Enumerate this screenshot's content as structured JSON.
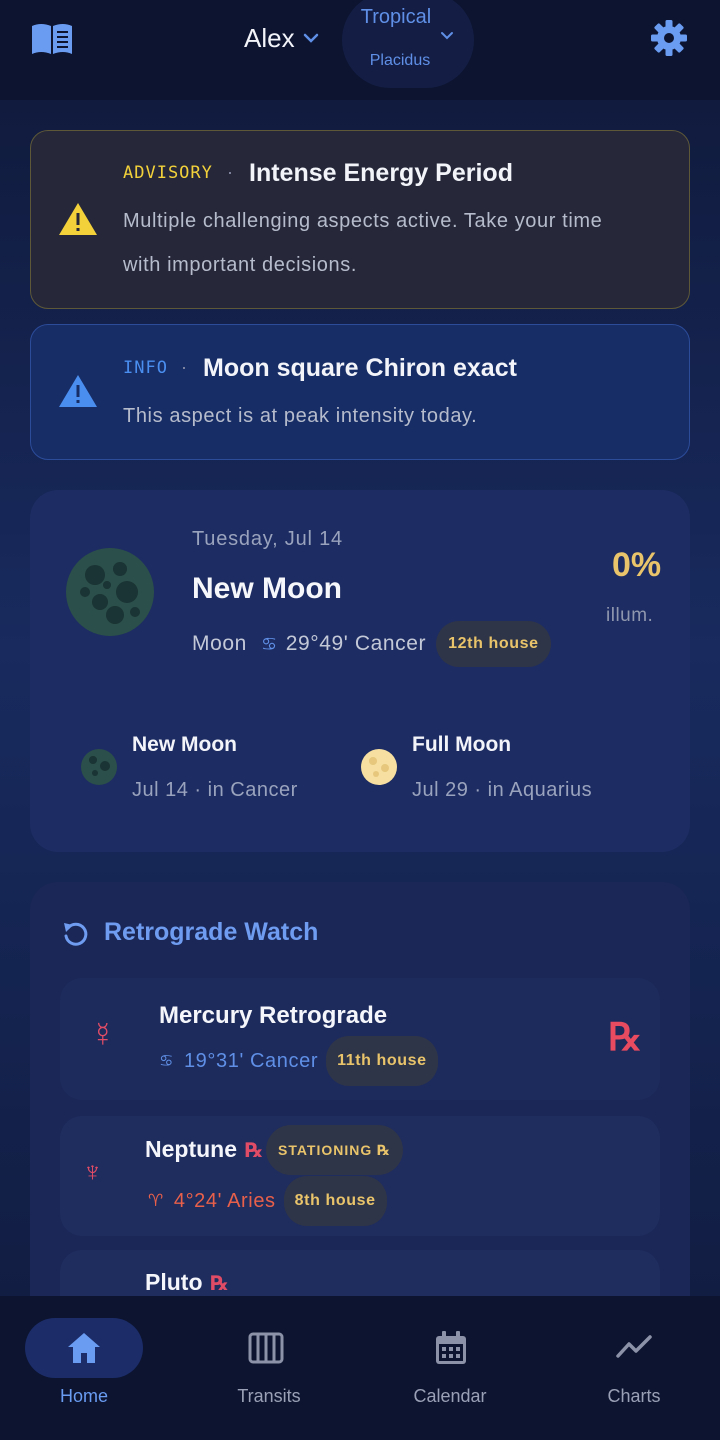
{
  "colors": {
    "accent": "#5f8fe6",
    "gold": "#e9c46a",
    "retro_red": "#e04c66",
    "advisory_yellow": "#f2d13a",
    "info_blue": "#4a8ef0",
    "fire_orange": "#e8604a"
  },
  "header": {
    "profile_name": "Alex",
    "zodiac": "Tropical",
    "house_system": "Placidus",
    "icons": [
      "book-icon",
      "chevron-down-icon",
      "gear-icon"
    ]
  },
  "alerts": [
    {
      "tag": "ADVISORY",
      "separator": "·",
      "title": "Intense Energy Period",
      "body_line1": "Multiple challenging aspects active. Take your time",
      "body_line2": "with important decisions.",
      "icon": "warning-icon"
    },
    {
      "tag": "INFO",
      "separator": "·",
      "title": "Moon square Chiron exact",
      "body_line1": "This aspect is at peak intensity today.",
      "icon": "warning-icon"
    }
  ],
  "moon": {
    "date": "Tuesday, Jul 14",
    "phase": "New Moon",
    "body": "Moon",
    "sign_symbol": "♋",
    "position": "29°49' Cancer",
    "house": "12th house",
    "illumination": "0%",
    "illumination_label": "illum.",
    "illumination_value": 0,
    "upcoming": [
      {
        "name": "New Moon",
        "detail": "Jul 14 · in Cancer",
        "icon": "new-moon-icon"
      },
      {
        "name": "Full Moon",
        "detail": "Jul 29 · in Aquarius",
        "icon": "full-moon-icon"
      }
    ]
  },
  "retrograde": {
    "title": "Retrograde Watch",
    "icon": "retrograde-refresh-icon",
    "planets": [
      {
        "glyph": "☿",
        "name": "Mercury Retrograde",
        "sign_symbol": "♋",
        "position": "19°31' Cancer",
        "house": "11th house",
        "rx": "℞"
      },
      {
        "glyph": "♆",
        "name": "Neptune",
        "rx": "℞",
        "badge": "STATIONING ℞",
        "sign_symbol": "♈",
        "position": "4°24' Aries",
        "house": "8th house"
      },
      {
        "glyph": "♇",
        "name": "Pluto",
        "rx": "℞"
      }
    ]
  },
  "nav": [
    {
      "label": "Home",
      "icon": "home-icon",
      "active": true
    },
    {
      "label": "Transits",
      "icon": "transits-icon",
      "active": false
    },
    {
      "label": "Calendar",
      "icon": "calendar-icon",
      "active": false
    },
    {
      "label": "Charts",
      "icon": "chart-line-icon",
      "active": false
    }
  ]
}
